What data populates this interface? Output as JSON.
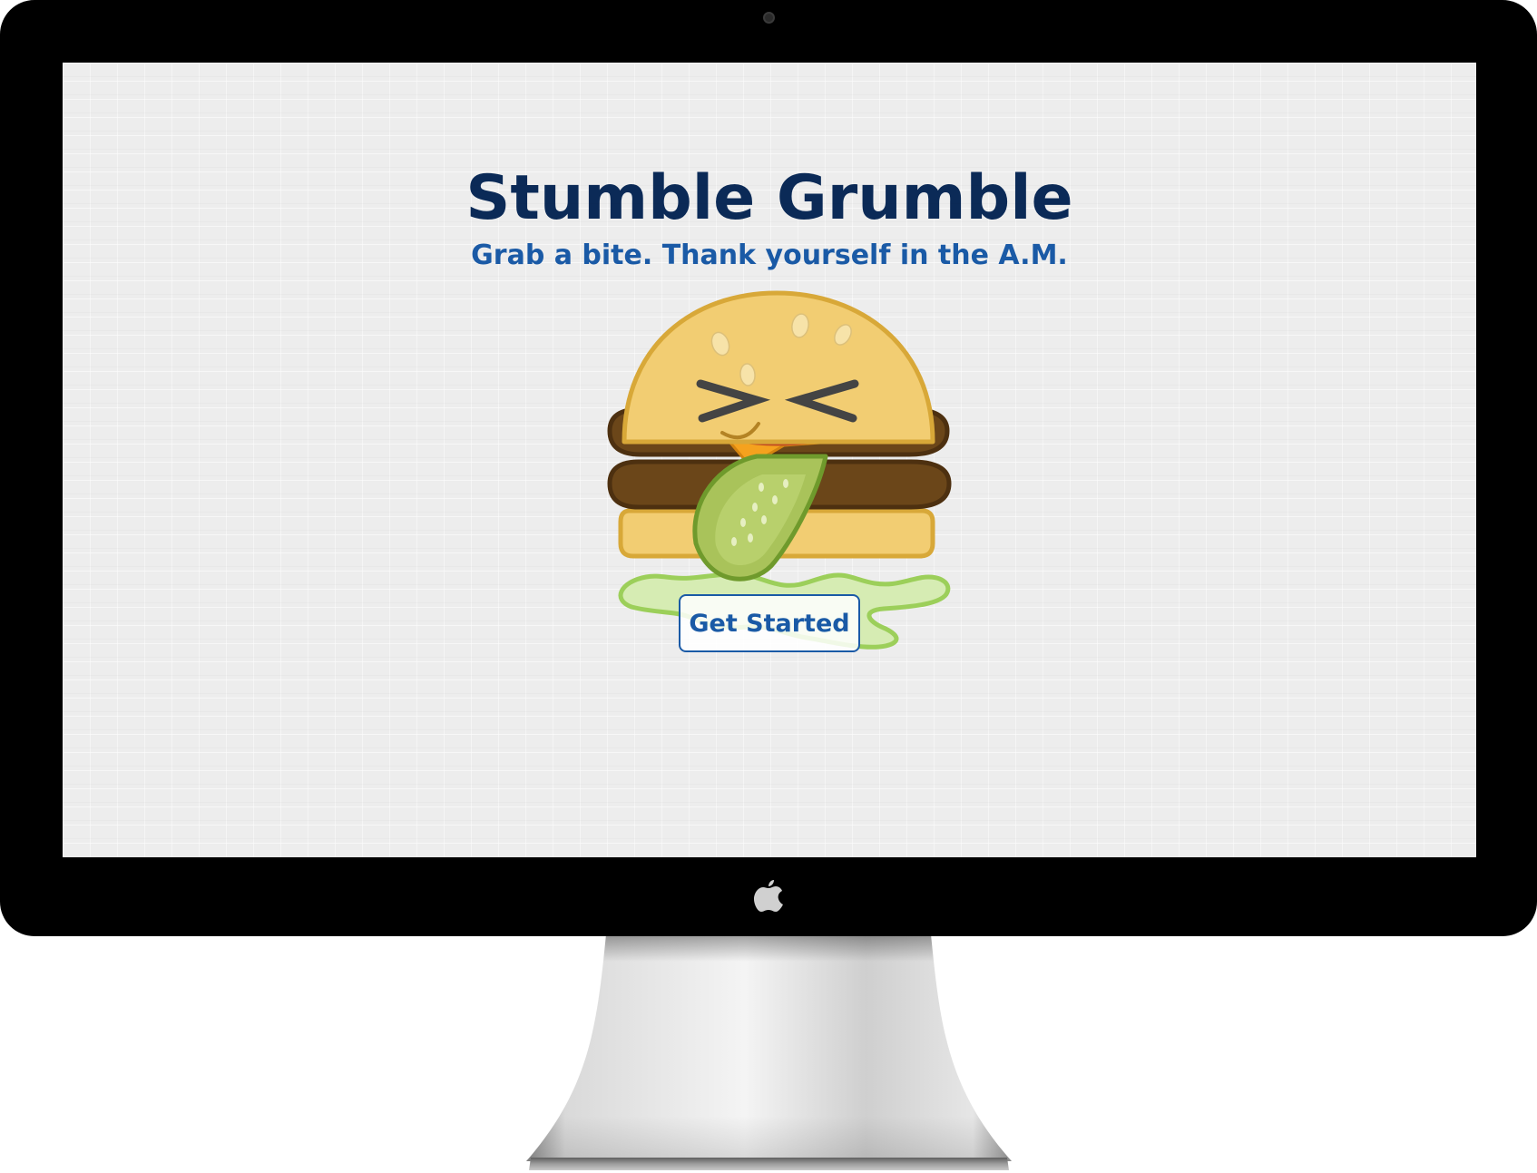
{
  "hero": {
    "title": "Stumble Grumble",
    "tagline": "Grab a bite. Thank yourself in the A.M.",
    "cta_label": "Get Started"
  },
  "illustration": {
    "subject": "burger-mascot",
    "icon_name": "burger-with-pickle-tongue"
  },
  "device": {
    "icon_name": "apple-logo"
  },
  "colors": {
    "title": "#0b2a57",
    "accent": "#1a5aa6",
    "screen_background": "#ededed",
    "bun": "#f2cd72",
    "patty": "#6b4619",
    "pickle": "#a9c35a",
    "lettuce": "#d6ecb3"
  }
}
